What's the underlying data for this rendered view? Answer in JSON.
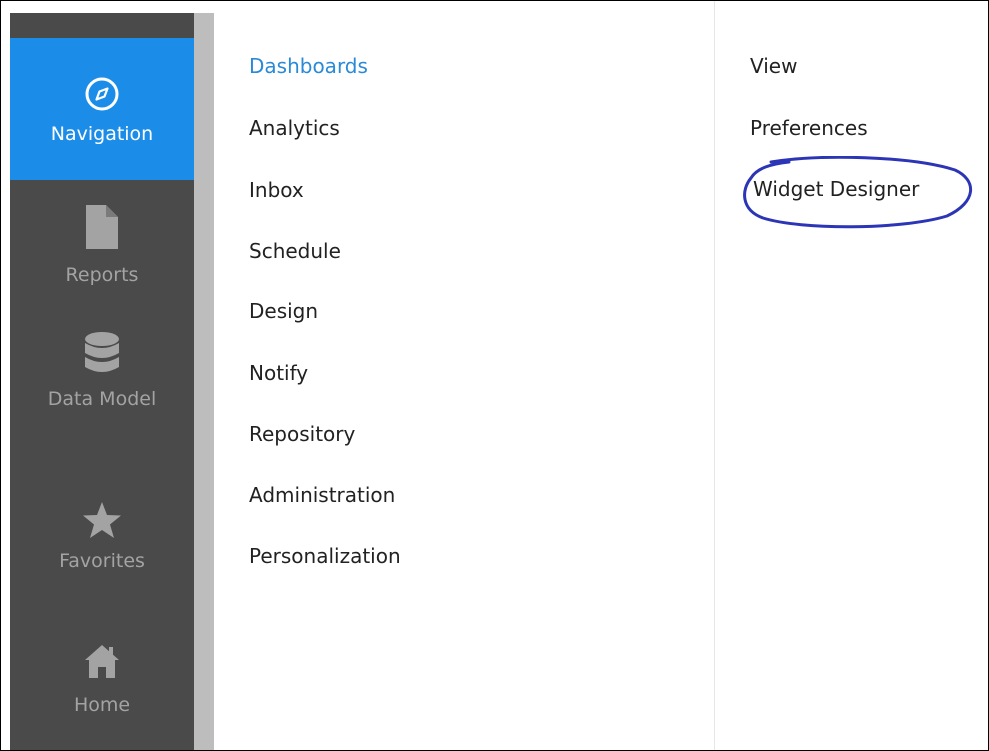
{
  "sidebar": {
    "items": [
      {
        "label": "Navigation",
        "icon": "compass-icon",
        "active": true
      },
      {
        "label": "Reports",
        "icon": "document-icon",
        "active": false
      },
      {
        "label": "Data Model",
        "icon": "database-icon",
        "active": false
      },
      {
        "label": "Favorites",
        "icon": "star-icon",
        "active": false
      },
      {
        "label": "Home",
        "icon": "home-icon",
        "active": false
      }
    ]
  },
  "menu": {
    "primary": [
      {
        "label": "Dashboards",
        "active": true
      },
      {
        "label": "Analytics",
        "active": false
      },
      {
        "label": "Inbox",
        "active": false
      },
      {
        "label": "Schedule",
        "active": false
      },
      {
        "label": "Design",
        "active": false
      },
      {
        "label": "Notify",
        "active": false
      },
      {
        "label": "Repository",
        "active": false
      },
      {
        "label": "Administration",
        "active": false
      },
      {
        "label": "Personalization",
        "active": false
      }
    ],
    "secondary": [
      {
        "label": "View"
      },
      {
        "label": "Preferences"
      },
      {
        "label": "Widget Designer",
        "highlighted": true
      }
    ]
  },
  "colors": {
    "accent": "#1b8de8",
    "active_link": "#2a8ad8",
    "rail_bg": "#4a4a4a",
    "rail_text": "#a3a3a3",
    "annotation": "#2b35b5"
  }
}
